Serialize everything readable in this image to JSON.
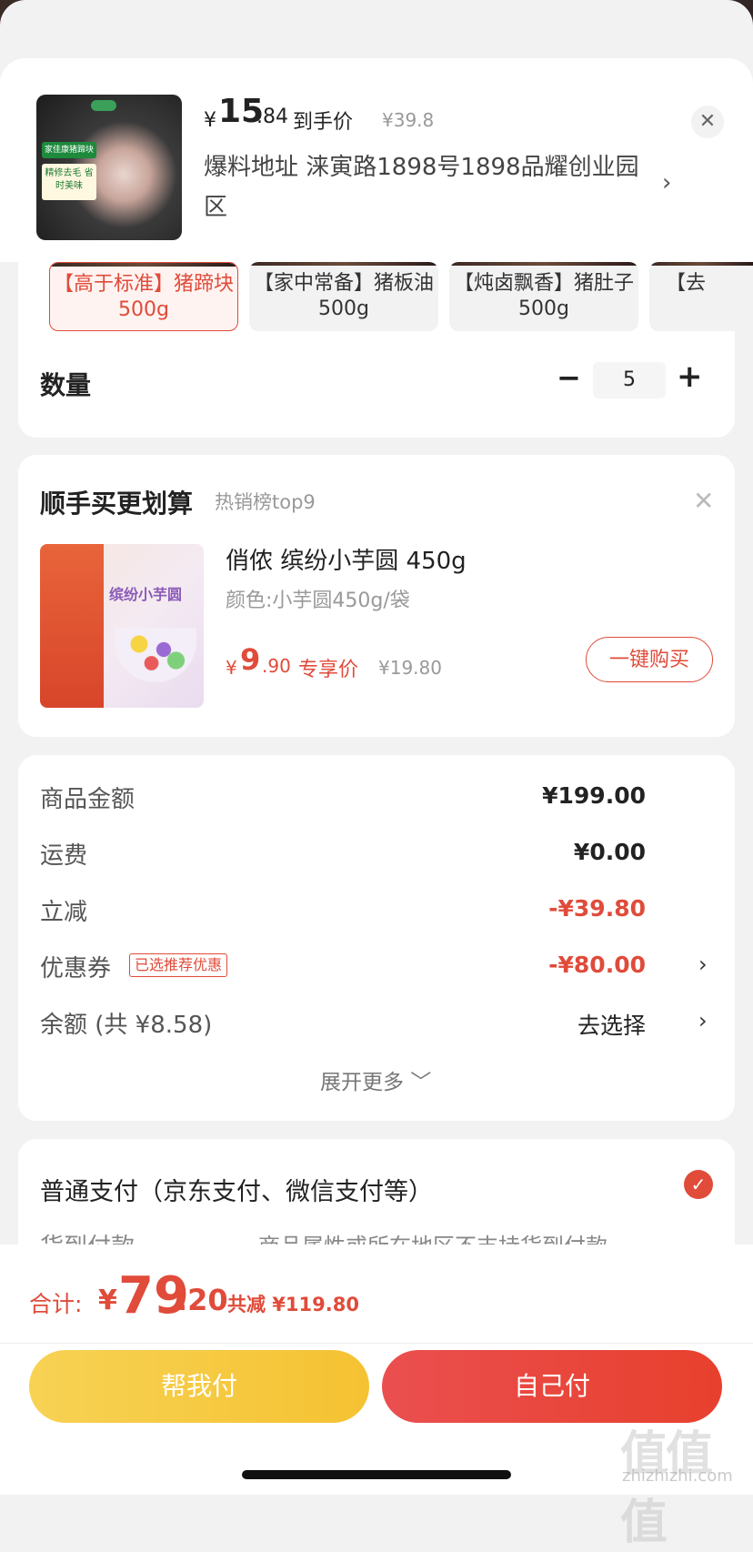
{
  "header": {
    "price_symbol": "¥",
    "price_int": "15",
    "price_dec": ".84",
    "price_label": "到手价",
    "original_price": "¥39.8",
    "address": "爆料地址  涞寅路1898号1898品耀创业园区",
    "close_icon": "close-icon",
    "chevron_icon": "chevron-right-icon",
    "thumb_text": [
      "家佳康猪蹄块",
      "精修去毛\n省时美味"
    ]
  },
  "variants": [
    {
      "label": "【高于标准】猪蹄块500g",
      "selected": true
    },
    {
      "label": "【家中常备】猪板油500g",
      "selected": false
    },
    {
      "label": "【炖卤飘香】猪肚子500g",
      "selected": false
    },
    {
      "label": "【去",
      "selected": false
    }
  ],
  "quantity": {
    "label": "数量",
    "minus": "−",
    "value": "5",
    "plus": "+"
  },
  "recommend": {
    "title": "顺手买更划算",
    "subtitle": "热销榜top9",
    "item": {
      "name": "俏侬 缤纷小芋圆 450g",
      "spec": "颜色:小芋圆450g/袋",
      "price_symbol": "¥",
      "price_int": "9",
      "price_dec": ".90",
      "price_label": "专享价",
      "original_price": "¥19.80",
      "buy_label": "一键购买",
      "package_text": "缤纷小芋圆"
    }
  },
  "summary": {
    "rows": [
      {
        "label": "商品金额",
        "value": "¥199.00"
      },
      {
        "label": "运费",
        "value": "¥0.00"
      },
      {
        "label": "立减",
        "value": "-¥39.80"
      },
      {
        "label": "优惠券",
        "tag": "已选推荐优惠",
        "value": "-¥80.00"
      },
      {
        "label": "余额 (共 ¥8.58)",
        "value": "去选择"
      }
    ],
    "expand": "展开更多 ﹀"
  },
  "payment": {
    "option1": "普通支付（京东支付、微信支付等）",
    "option2": "货到付款",
    "option2_note": "商品属性或所在地区不支持货到付款"
  },
  "footer": {
    "total_label": "合计:",
    "total_symbol": "¥",
    "total_int": "79",
    "total_dec": ".20",
    "total_saved": "共减 ¥119.80",
    "help_pay": "帮我付",
    "self_pay": "自己付"
  },
  "watermark": {
    "logo": "值值值",
    "site": "zhizhizhi.com"
  },
  "colors": {
    "accent": "#e04b3a",
    "yellow": "#f5c232",
    "bg": "#f2f2f2"
  }
}
